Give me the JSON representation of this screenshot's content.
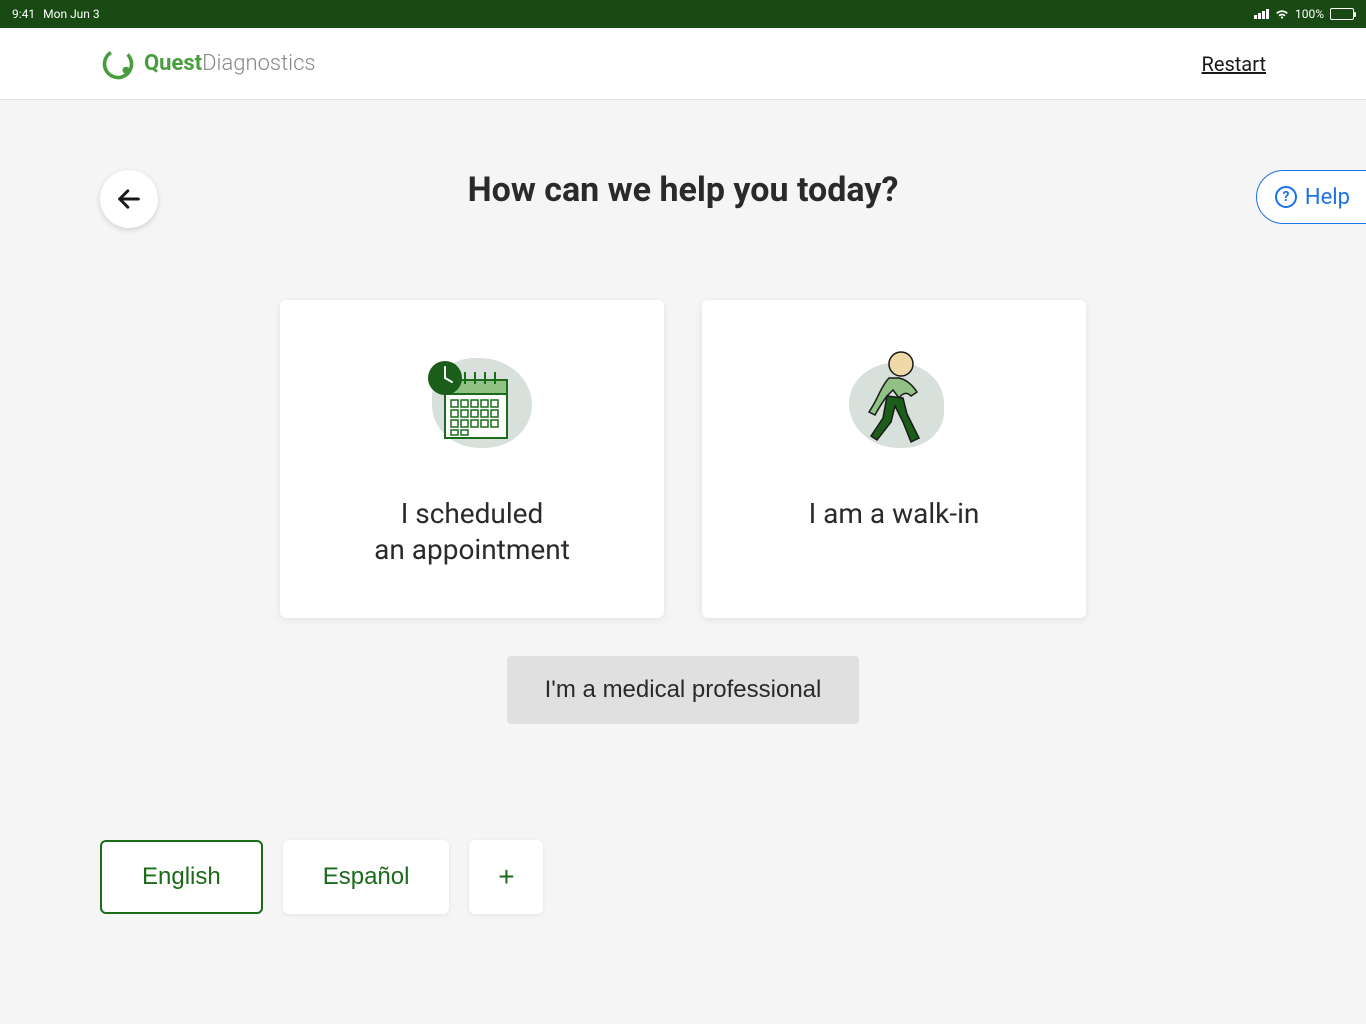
{
  "statusBar": {
    "time": "9:41",
    "date": "Mon Jun 3",
    "batteryPct": "100%"
  },
  "header": {
    "brandBold": "Quest",
    "brandLight": "Diagnostics",
    "restart": "Restart"
  },
  "page": {
    "title": "How can we help you today?",
    "help": "Help"
  },
  "options": {
    "scheduled": "I scheduled\nan appointment",
    "walkin": "I am a walk-in",
    "professional": "I'm a medical professional"
  },
  "languages": {
    "english": "English",
    "spanish": "Español",
    "more": "+"
  },
  "colors": {
    "accent": "#1a6b1a",
    "helpBlue": "#1a73e8",
    "statusBg": "#1a4a14"
  }
}
